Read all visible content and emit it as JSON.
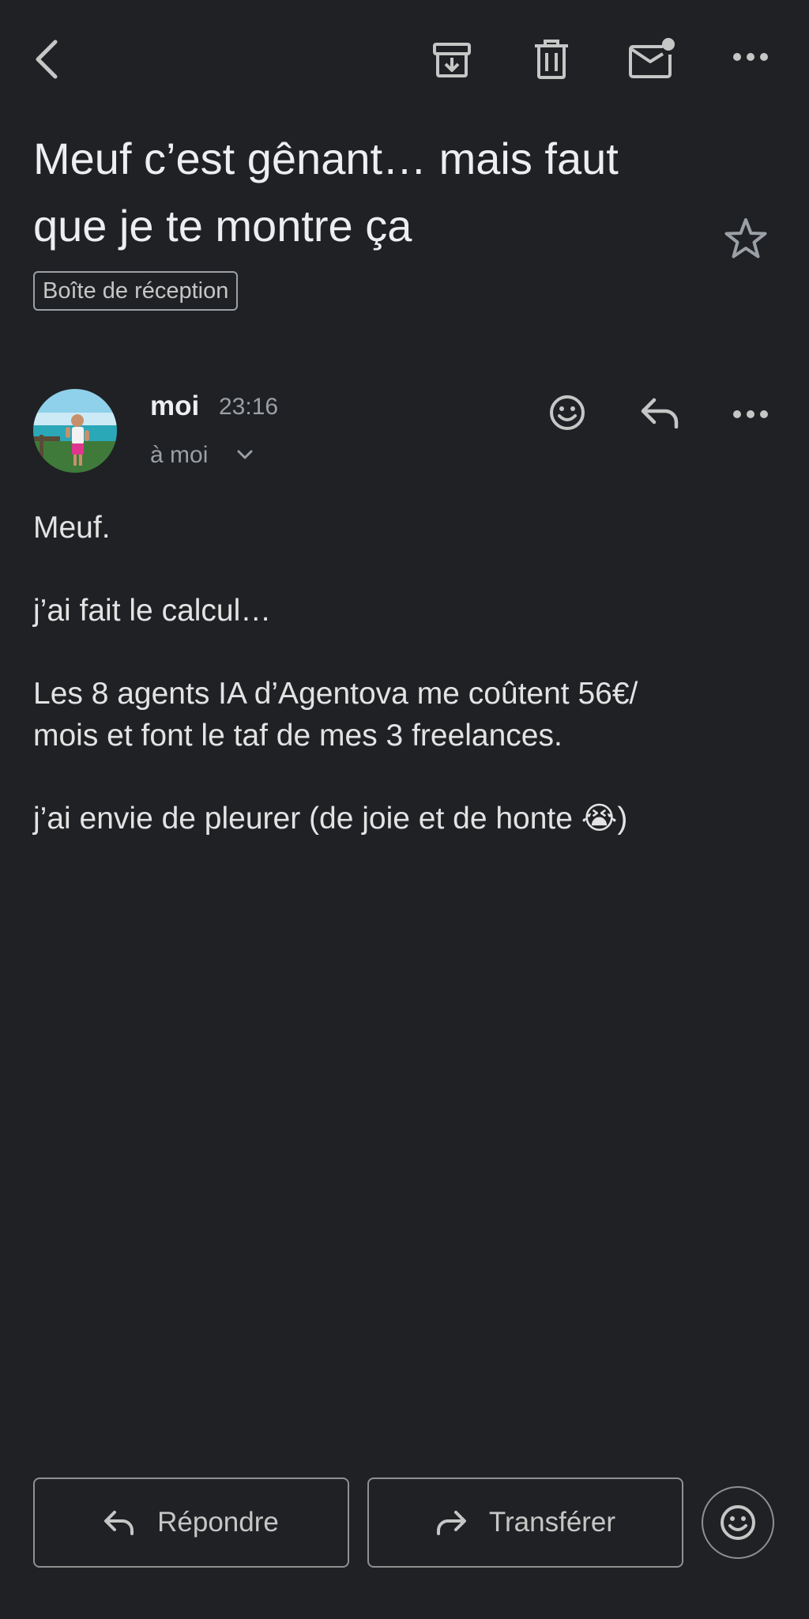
{
  "toolbar": {
    "back_icon": "chevron-left-icon",
    "archive_icon": "archive-icon",
    "delete_icon": "trash-icon",
    "mark_unread_icon": "mail-unread-icon",
    "more_icon": "more-horizontal-icon"
  },
  "email": {
    "subject_line1": "Meuf c’est gênant… mais faut",
    "subject_line2": "que je te montre ça",
    "label": "Boîte de réception",
    "starred": false
  },
  "message": {
    "sender": "moi",
    "time": "23:16",
    "recipient": "à moi",
    "body": {
      "line1": "Meuf.",
      "line2": "j’ai fait le calcul…",
      "line3": "Les 8 agents IA d’Agentova me coûtent 56€/",
      "line4": "mois et font le taf de mes 3 freelances.",
      "line5": "j’ai envie de pleurer (de joie et de honte ",
      "emoji": "😭",
      "line5_end": ")"
    }
  },
  "actions": {
    "reply_label": "Répondre",
    "forward_label": "Transférer"
  },
  "colors": {
    "background": "#202124",
    "text_primary": "#eceef0",
    "text_secondary": "#9aa0a6",
    "icon": "#c4c7c5",
    "border": "#8e918f"
  }
}
